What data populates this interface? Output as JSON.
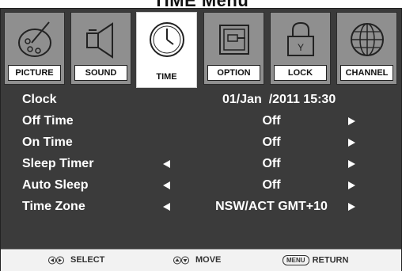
{
  "title": "TIME Menu",
  "tabs": [
    {
      "label": "PICTURE",
      "icon": "picture-icon",
      "active": false
    },
    {
      "label": "SOUND",
      "icon": "speaker-icon",
      "active": false
    },
    {
      "label": "TIME",
      "icon": "clock-icon",
      "active": true
    },
    {
      "label": "OPTION",
      "icon": "option-icon",
      "active": false
    },
    {
      "label": "LOCK",
      "icon": "lock-icon",
      "active": false
    },
    {
      "label": "CHANNEL",
      "icon": "globe-icon",
      "active": false
    }
  ],
  "rows": [
    {
      "label": "Clock",
      "value": "01/Jan  /2011 15:30"
    },
    {
      "label": "Off Time",
      "value": "Off"
    },
    {
      "label": "On Time",
      "value": "Off"
    },
    {
      "label": "Sleep Timer",
      "value": "Off"
    },
    {
      "label": "Auto Sleep",
      "value": "Off"
    },
    {
      "label": "Time Zone",
      "value": "NSW/ACT GMT+10"
    }
  ],
  "footer": {
    "select": "SELECT",
    "move": "MOVE",
    "menu_key": "MENU",
    "return": "RETURN"
  },
  "colors": {
    "background": "#3b3b3b",
    "tab": "#8f8f8f",
    "active_tab": "#ffffff",
    "text": "#ffffff"
  }
}
